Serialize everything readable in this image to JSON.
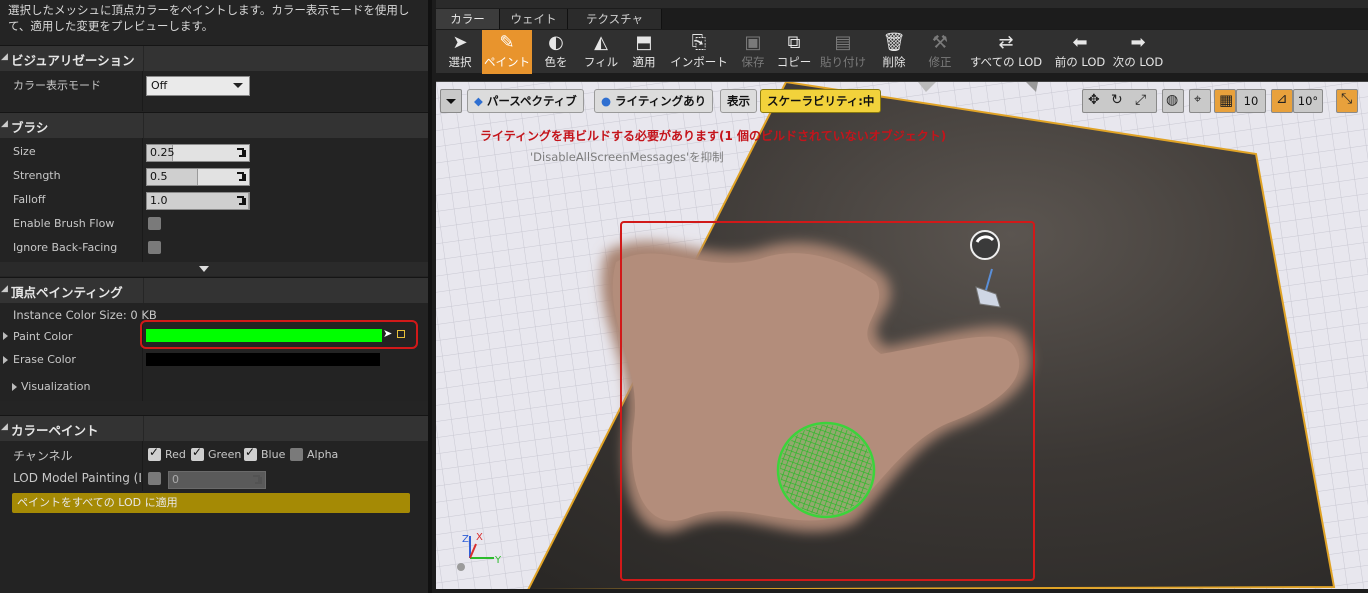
{
  "left_panel": {
    "description": "選択したメッシュに頂点カラーをペイントします。カラー表示モードを使用して、適用した変更をプレビューします。",
    "visualization": {
      "title": "ビジュアリゼーション",
      "color_view_mode_label": "カラー表示モード",
      "color_view_mode_value": "Off"
    },
    "brush": {
      "title": "ブラシ",
      "size_label": "Size",
      "size_value": "0.25",
      "size_fraction": 0.25,
      "strength_label": "Strength",
      "strength_value": "0.5",
      "strength_fraction": 0.5,
      "falloff_label": "Falloff",
      "falloff_value": "1.0",
      "falloff_fraction": 1.0,
      "enable_brush_flow_label": "Enable Brush Flow",
      "enable_brush_flow": false,
      "ignore_back_facing_label": "Ignore Back-Facing",
      "ignore_back_facing": false
    },
    "vertex_painting": {
      "title": "頂点ペインティング",
      "instance_color_size": "Instance Color Size: 0 KB",
      "paint_color_label": "Paint Color",
      "paint_color": "#00ff00",
      "erase_color_label": "Erase Color",
      "erase_color": "#000000",
      "visualization_label": "Visualization"
    },
    "color_paint": {
      "title": "カラーペイント",
      "channels_label": "チャンネル",
      "channels": [
        {
          "label": "Red",
          "checked": true
        },
        {
          "label": "Green",
          "checked": true
        },
        {
          "label": "Blue",
          "checked": true
        },
        {
          "label": "Alpha",
          "checked": false
        }
      ],
      "lod_label": "LOD Model Painting (LC",
      "lod_value": "0",
      "apply_all_lod_button": "ペイントをすべての LOD に適用"
    }
  },
  "mode_tabs": [
    "カラー",
    "ウェイト",
    "テクスチャ"
  ],
  "toolbar": [
    {
      "label": "選択",
      "icon": "cursor-icon",
      "state": "normal"
    },
    {
      "label": "ペイント",
      "icon": "brush-icon",
      "state": "active"
    },
    {
      "label": "色を",
      "icon": "swap-color-icon",
      "state": "normal"
    },
    {
      "label": "フィル",
      "icon": "fill-bucket-icon",
      "state": "normal"
    },
    {
      "label": "適用",
      "icon": "apply-icon",
      "state": "normal"
    },
    {
      "label": "インポート",
      "icon": "import-icon",
      "state": "normal"
    },
    {
      "label": "保存",
      "icon": "save-icon",
      "state": "disabled"
    },
    {
      "label": "コピー",
      "icon": "copy-icon",
      "state": "normal"
    },
    {
      "label": "貼り付け",
      "icon": "paste-icon",
      "state": "disabled"
    },
    {
      "label": "削除",
      "icon": "trash-icon",
      "state": "normal"
    },
    {
      "label": "修正",
      "icon": "fix-icon",
      "state": "disabled"
    },
    {
      "label": "すべての LOD",
      "icon": "all-lod-icon",
      "state": "normal"
    },
    {
      "label": "前の LOD",
      "icon": "arrow-left-icon",
      "state": "normal"
    },
    {
      "label": "次の LOD",
      "icon": "arrow-right-icon",
      "state": "normal"
    }
  ],
  "viewport": {
    "perspective_label": "パースペクティブ",
    "lighting_label": "ライティングあり",
    "show_label": "表示",
    "scalability_label": "スケーラビリティ:中",
    "grid_snap_value": "10",
    "rotation_snap_value": "10°",
    "lighting_warning": "ライティングを再ビルドする必要があります(1 個のビルドされていないオブジェクト)",
    "suppress_hint": "'DisableAllScreenMessages'を抑制",
    "axis_labels": {
      "x": "X",
      "y": "Y",
      "z": "Z"
    }
  },
  "colors": {
    "accent_orange": "#e8942d",
    "highlight_red": "#d11919",
    "scalability_yellow": "#f2d23b"
  }
}
